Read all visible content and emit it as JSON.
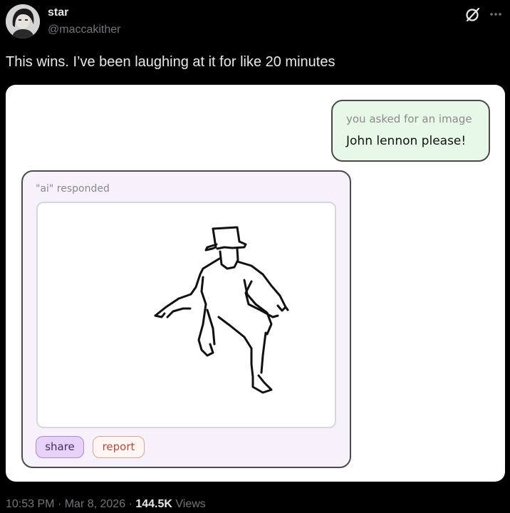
{
  "author": {
    "display_name": "star",
    "handle": "@maccakither"
  },
  "tweet": {
    "text": "This wins. I’ve been laughing at it for like 20 minutes"
  },
  "media": {
    "request_caption": "you asked for an image",
    "request_text": "John lennon please!",
    "response_caption": "\"ai\" responded",
    "share_label": "share",
    "report_label": "report"
  },
  "meta": {
    "time": "10:53 PM",
    "date": "Mar 8, 2026",
    "views_count": "144.5K",
    "views_label": "Views",
    "separator": "·"
  },
  "icons": {
    "grok": "grok-icon",
    "more": "more-icon"
  },
  "colors": {
    "background": "#000000",
    "request_bubble": "#e7f7e8",
    "response_card": "#f7f1fb",
    "share_button": "#e6d2f7",
    "report_button": "#fff6f4"
  }
}
